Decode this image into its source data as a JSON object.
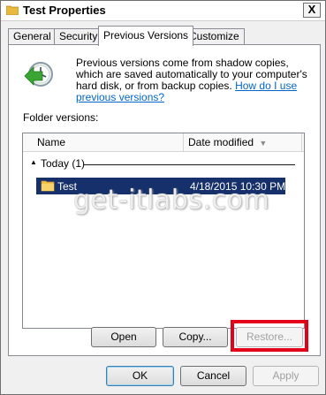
{
  "window": {
    "title": "Test Properties",
    "close_label": "X"
  },
  "tabs": [
    {
      "label": "General",
      "active": false
    },
    {
      "label": "Security",
      "active": false
    },
    {
      "label": "Previous Versions",
      "active": true
    },
    {
      "label": "Customize",
      "active": false
    }
  ],
  "info": {
    "text": "Previous versions come from shadow copies, which are saved automatically to your computer's hard disk, or from backup copies.",
    "link": "How do I use previous versions?",
    "icon": "restore-clock-icon"
  },
  "folder_versions": {
    "label": "Folder versions:",
    "columns": {
      "name": "Name",
      "date": "Date modified"
    },
    "group": {
      "label": "Today (1)"
    },
    "rows": [
      {
        "name": "Test",
        "date": "4/18/2015 10:30 PM",
        "selected": true,
        "icon": "folder-icon"
      }
    ]
  },
  "actions": {
    "open": "Open",
    "copy": "Copy...",
    "restore": "Restore..."
  },
  "footer": {
    "ok": "OK",
    "cancel": "Cancel",
    "apply": "Apply"
  },
  "watermark": "get-itlabs.com",
  "colors": {
    "selection": "#16306b",
    "highlight_box": "#e3001b",
    "link": "#0066cc"
  }
}
